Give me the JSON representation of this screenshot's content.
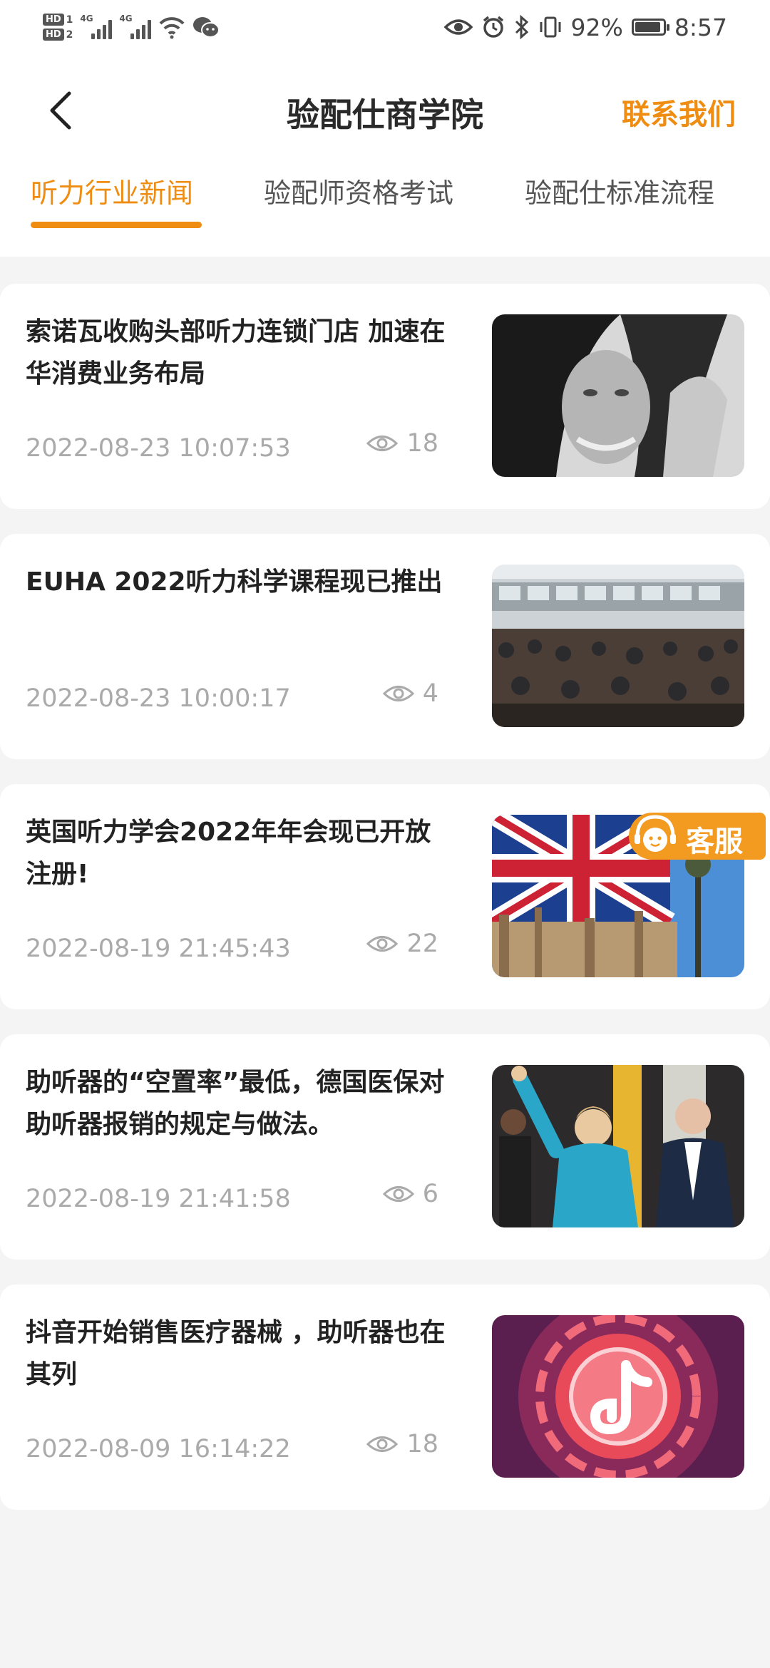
{
  "status_bar": {
    "sim1": "HD",
    "sim1_num": "1",
    "sim2": "HD",
    "sim2_num": "2",
    "network1": "4G",
    "network2": "4G",
    "battery": "92%",
    "battery_level": 0.92,
    "time": "8:57"
  },
  "header": {
    "back_icon": "chevron-left-icon",
    "title": "验配仕商学院",
    "contact": "联系我们"
  },
  "tabs": [
    {
      "label": "听力行业新闻",
      "active": true
    },
    {
      "label": "验配师资格考试",
      "active": false
    },
    {
      "label": "验配仕标准流程",
      "active": false
    }
  ],
  "accent": "#ef8d13",
  "articles": [
    {
      "title": "索诺瓦收购头部听力连锁门店 加速在华消费业务布局",
      "date": "2022-08-23 10:07:53",
      "views": "18"
    },
    {
      "title": "EUHA 2022听力科学课程现已推出",
      "date": "2022-08-23 10:00:17",
      "views": "4"
    },
    {
      "title": "英国听力学会2022年年会现已开放注册!",
      "date": "2022-08-19 21:45:43",
      "views": "22"
    },
    {
      "title": "助听器的“空置率”最低，德国医保对助听器报销的规定与做法。",
      "date": "2022-08-19 21:41:58",
      "views": "6"
    },
    {
      "title": "抖音开始销售医疗器械 ，助听器也在其列",
      "date": "2022-08-09 16:14:22",
      "views": "18"
    }
  ],
  "customer_service": {
    "label": "客服"
  }
}
